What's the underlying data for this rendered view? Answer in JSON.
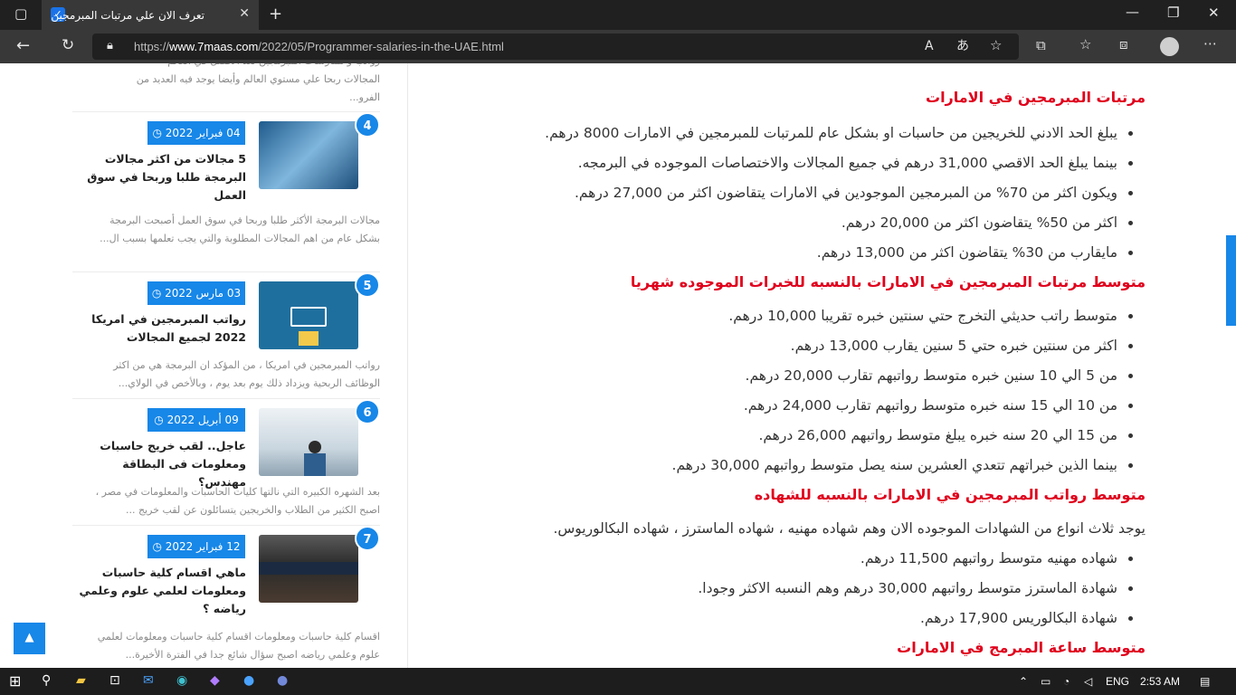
{
  "browser": {
    "tab_title": "تعرف الان علي مرتبات المبرمجين ف...",
    "url_prefix": "https://",
    "url_domain": "www.7maas.com",
    "url_path": "/2022/05/Programmer-salaries-in-the-UAE.html"
  },
  "sidebar": {
    "top_snippet": [
      "رواتب و ممارسات المبرمجين تعد الافضل في العالم",
      "المجالات ربحا علي مستوي العالم وأيضا يوجد فيه العديد من",
      "الفرو..."
    ],
    "cards": [
      {
        "num": "4",
        "date": "04 فبراير 2022",
        "title": "5 مجالات من اكثر مجالات البرمجة طلبا وربحا في سوق العمل",
        "snippet": "مجالات البرمجة الأكثر طلبا وربحا في سوق العمل أصبحت البرمجة بشكل عام من اهم المجالات المطلوبة والتي يجب تعلمها بسبب ال..."
      },
      {
        "num": "5",
        "date": "03 مارس 2022",
        "title": "رواتب المبرمجين في امريكا 2022 لجميع المجالات",
        "snippet": "رواتب المبرمجين في امريكا ، من المؤكد ان البرمجة هي من اكثر الوظائف الربحية ويزداد ذلك يوم بعد يوم ، وبالأخص في الولاي..."
      },
      {
        "num": "6",
        "date": "09 أبريل 2022",
        "title": "عاجل.. لقب خريج حاسبات ومعلومات فى البطاقة مهندس؟",
        "snippet": "بعد الشهره الكبيره التي نالتها كليات الحاسبات والمعلومات في مصر ، اصبح الكثير من الطلاب والخريجين يتسائلون عن لقب خريج ..."
      },
      {
        "num": "7",
        "date": "12 فبراير 2022",
        "title": "ماهي اقسام كلية حاسبات ومعلومات لعلمي علوم وعلمي رياضه ؟",
        "snippet": "اقسام كلية حاسبات ومعلومات اقسام كلية حاسبات ومعلومات لعلمي علوم وعلمي رياضه اصبح سؤال شائع جدا في الفترة الأخيرة..."
      }
    ]
  },
  "article": {
    "h1": "مرتبات المبرمجين في الامارات",
    "list1": [
      "يبلغ الحد الادني للخريجين من حاسبات او بشكل عام للمرتبات للمبرمجين في الامارات 8000 درهم.",
      "بينما يبلغ الحد الاقصي 31,000 درهم في جميع المجالات والاختصاصات الموجوده في البرمجه.",
      "ويكون اكثر من 70% من المبرمجين الموجودين في الامارات يتقاضون اكثر من 27,000 درهم.",
      "اكثر من 50% يتقاضون اكثر من 20,000 درهم.",
      "مايقارب من 30% يتقاضون اكثر من 13,000 درهم."
    ],
    "h2": "متوسط مرتبات المبرمجين في الامارات بالنسبه للخبرات الموجوده شهريا",
    "list2": [
      "متوسط راتب حديثي التخرج حتي سنتين خبره تقريبا 10,000 درهم.",
      "اكثر من سنتين خبره حتي 5 سنين يقارب 13,000 درهم.",
      "من 5 الي 10 سنين خبره متوسط رواتبهم تقارب 20,000 درهم.",
      "من 10 الي 15 سنه خبره متوسط رواتبهم تقارب 24,000 درهم.",
      "من 15 الي 20 سنه خبره يبلغ متوسط رواتبهم 26,000 درهم.",
      "بينما الذين خبراتهم تتعدي العشرين سنه يصل متوسط رواتبهم 30,000 درهم."
    ],
    "h3": "متوسط رواتب المبرمجين في الامارات بالنسبه للشهاده",
    "para": "يوجد ثلاث انواع من الشهادات الموجوده الان وهم شهاده مهنيه ، شهاده الماسترز ، شهاده البكالوريوس.",
    "list3": [
      "شهاده مهنيه متوسط رواتبهم 11,500 درهم.",
      "شهادة الماسترز متوسط رواتبهم 30,000 درهم وهم النسبه الاكثر وجودا.",
      "شهادة البكالوريس 17,900 درهم."
    ],
    "h4": "متوسط ساعة المبرمج في الامارات"
  },
  "taskbar": {
    "lang": "ENG",
    "time": "2:53 AM"
  }
}
